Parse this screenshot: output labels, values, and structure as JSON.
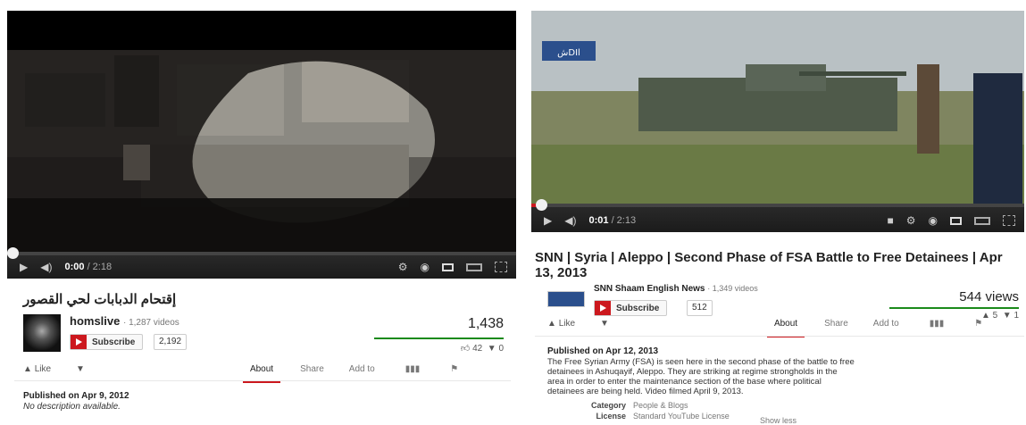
{
  "left_video": {
    "time_current": "0:00",
    "time_total": "/ 2:18",
    "progress": 0.0,
    "title": "إقتحام الدبابات لحي القصور",
    "channel_name": "homslive",
    "video_count": "· 1,287 videos",
    "subscribe_label": "Subscribe",
    "subscriber_count": "2,192",
    "views": "1,438",
    "likes": "42",
    "dislikes": "0",
    "like_label": "Like",
    "tabs": [
      "About",
      "Share",
      "Add to"
    ],
    "active_tab": "About",
    "published": "Published on Apr 9, 2012",
    "description": "No description available."
  },
  "right_video": {
    "time_current": "0:01",
    "time_total": "/ 2:13",
    "progress": 0.01,
    "title": "SNN | Syria | Aleppo | Second Phase of FSA Battle to Free Detainees | Apr 13, 2013",
    "channel_name": "SNN Shaam English News",
    "video_count": "· 1,349 videos",
    "subscribe_label": "Subscribe",
    "subscriber_count": "512",
    "views": "544 views",
    "likes": "5",
    "dislikes": "1",
    "like_label": "Like",
    "tabs": [
      "About",
      "Share",
      "Add to"
    ],
    "active_tab": "About",
    "published": "Published on Apr 12, 2013",
    "description": "The Free Syrian Army (FSA) is seen here in the second phase of the battle to free detainees in Ashuqayif, Aleppo. They are striking at regime strongholds in the area in order to enter the maintenance section of the base where political detainees are being held. Video filmed April 9, 2013.",
    "category_label": "Category",
    "category_value": "People & Blogs",
    "license_label": "License",
    "license_value": "Standard YouTube License",
    "show_less": "Show less",
    "logo_text": "شDIا"
  },
  "colors": {
    "accent": "#cc181e",
    "views_bar": "#1b8a1b",
    "player": "#1b1b1b"
  },
  "icons": [
    "play-icon",
    "volume-icon",
    "gear-icon",
    "annotations-icon",
    "small-player-icon",
    "large-player-icon",
    "fullscreen-icon",
    "thumbs-up-icon",
    "thumbs-down-icon",
    "stats-icon",
    "flag-icon",
    "subscribe-icon",
    "captions-icon"
  ]
}
